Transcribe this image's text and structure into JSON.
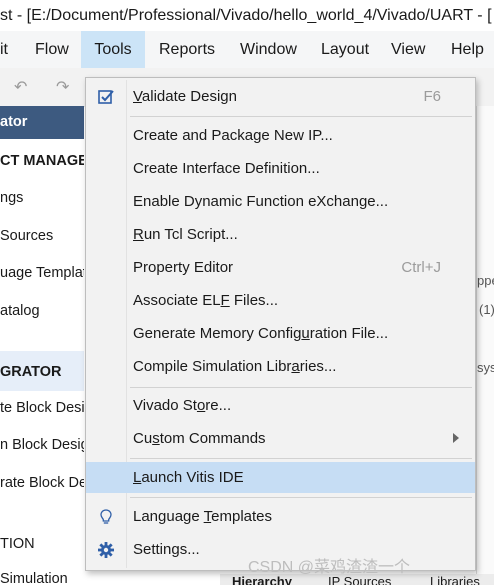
{
  "window": {
    "title": "st - [E:/Document/Professional/Vivado/hello_world_4/Vivado/UART - ["
  },
  "menubar": {
    "items": [
      {
        "label": "it"
      },
      {
        "label": "Flow"
      },
      {
        "label": "Tools",
        "active": true
      },
      {
        "label": "Reports"
      },
      {
        "label": "Window"
      },
      {
        "label": "Layout"
      },
      {
        "label": "View"
      },
      {
        "label": "Help"
      }
    ]
  },
  "flow_navigator": {
    "header": "ator",
    "items": [
      {
        "label": "CT MANAGER",
        "section": true
      },
      {
        "label": "ngs"
      },
      {
        "label": "Sources"
      },
      {
        "label": "uage Templat"
      },
      {
        "label": "atalog"
      },
      {
        "label": "GRATOR",
        "section": true
      },
      {
        "label": "te Block Desi"
      },
      {
        "label": "n Block Desig"
      },
      {
        "label": "rate Block De"
      },
      {
        "label": "TION"
      },
      {
        "label": "Simulation"
      }
    ]
  },
  "right_pane": {
    "texts": [
      "ppe",
      "(1)",
      "sys"
    ]
  },
  "bottom_tabs": [
    "Hierarchy",
    "IP Sources",
    "Libraries"
  ],
  "tools_menu": {
    "items": [
      {
        "label_prefix": "",
        "underline": "V",
        "label_suffix": "alidate Design",
        "shortcut": "F6",
        "icon": "validate-checkbox-icon"
      },
      {
        "label_prefix": "Create and Package New IP...",
        "underline": "",
        "label_suffix": ""
      },
      {
        "label_prefix": "Create Interface Definition...",
        "underline": "",
        "label_suffix": ""
      },
      {
        "label_prefix": "Enable Dynamic Function eXchange...",
        "underline": "",
        "label_suffix": ""
      },
      {
        "label_prefix": "",
        "underline": "R",
        "label_suffix": "un Tcl Script..."
      },
      {
        "label_prefix": "Property Editor",
        "underline": "",
        "label_suffix": "",
        "shortcut": "Ctrl+J"
      },
      {
        "label_prefix": "Associate EL",
        "underline": "F",
        "label_suffix": " Files..."
      },
      {
        "label_prefix": "Generate Memory Config",
        "underline": "u",
        "label_suffix": "ration File..."
      },
      {
        "label_prefix": "Compile Simulation Libr",
        "underline": "a",
        "label_suffix": "ries..."
      },
      {
        "label_prefix": "Vivado St",
        "underline": "o",
        "label_suffix": "re..."
      },
      {
        "label_prefix": "Cu",
        "underline": "s",
        "label_suffix": "tom Commands",
        "submenu": true
      },
      {
        "label_prefix": "",
        "underline": "L",
        "label_suffix": "aunch Vitis IDE",
        "highlighted": true
      },
      {
        "label_prefix": "Language ",
        "underline": "T",
        "label_suffix": "emplates",
        "icon": "lightbulb-icon"
      },
      {
        "label_prefix": "Settings...",
        "underline": "",
        "label_suffix": "",
        "icon": "gear-icon"
      }
    ]
  },
  "watermark": "CSDN @菜鸡渣渣一个",
  "colors": {
    "menu_highlight": "#c6ddf4",
    "active_menubar": "#cce4f7",
    "nav_header": "#3d5a80",
    "icon_blue": "#2f5fa8"
  }
}
